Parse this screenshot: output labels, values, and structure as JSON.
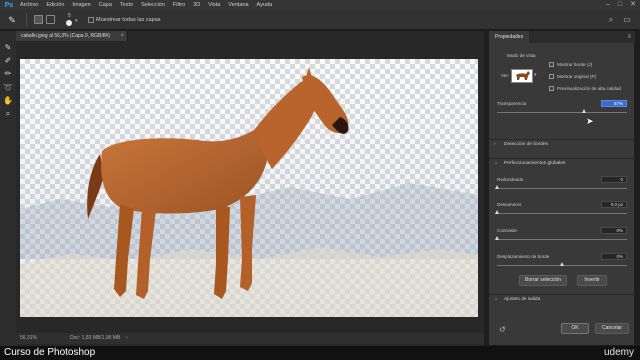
{
  "menu": {
    "logo": "Ps",
    "items": [
      "Archivo",
      "Edición",
      "Imagen",
      "Capa",
      "Texto",
      "Selección",
      "Filtro",
      "3D",
      "Vista",
      "Ventana",
      "Ayuda"
    ]
  },
  "options_bar": {
    "brush_size": "5",
    "sample_all_layers_label": "Muestrear todas las capas",
    "sample_all_layers_checked": false
  },
  "document": {
    "tab_title": "caballo.jpeg al 56,3% (Capa 0, RGB/8#)",
    "zoom_status": "56,31%",
    "doc_info": "Doc: 1,83 MB/1,96 MB"
  },
  "properties": {
    "tab_label": "Propiedades",
    "view_mode_label": "Modo de vista",
    "view_label": "Ver:",
    "show_edge_label": "Mostrar borde (J)",
    "show_original_label": "Mostrar original (P)",
    "hq_preview_label": "Previsualización de alta calidad",
    "transparency_label": "Transparencia",
    "transparency_value": "67%",
    "edge_detection_label": "Detección de bordes",
    "global_refinements_label": "Perfeccionamientos globales",
    "smooth_label": "Redondeado",
    "smooth_value": "0",
    "feather_label": "Desvanecer",
    "feather_value": "0,0 px",
    "contrast_label": "Contraste",
    "contrast_value": "0%",
    "shift_edge_label": "Desplazamiento de borde",
    "shift_edge_value": "0%",
    "clear_selection_button": "Borrar selección",
    "invert_button": "Invertir",
    "output_settings_label": "Ajustes de salida",
    "ok_button": "OK",
    "cancel_button": "Cancelar"
  },
  "slider_levels": {
    "transparency": 0.67,
    "smooth": 0,
    "feather": 0,
    "contrast": 0,
    "shift_edge": 0.5
  },
  "caption": {
    "course_title": "Curso de Photoshop",
    "brand": "udemy"
  },
  "colors": {
    "accent_blue": "#31a8ff",
    "highlight_field": "#3b6cc9",
    "horse": "#b0622c"
  }
}
